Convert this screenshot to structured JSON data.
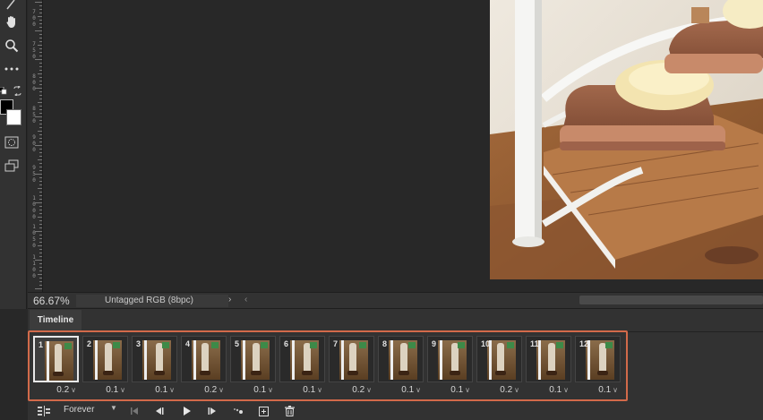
{
  "status": {
    "zoom": "66.67%",
    "color_profile": "Untagged RGB (8bpc)",
    "next_glyph": "›",
    "prev_glyph": "‹"
  },
  "panel": {
    "tab_label": "Timeline"
  },
  "ruler": {
    "labels": [
      "7\n0\n0",
      "7\n5\n0",
      "8\n0\n0",
      "8\n5\n0",
      "9\n0\n0",
      "9\n5\n0",
      "1\n0\n0\n0",
      "1\n0\n5\n0",
      "1\n1\n0\n0"
    ]
  },
  "frames": [
    {
      "num": "1",
      "delay": "0.2",
      "selected": true
    },
    {
      "num": "2",
      "delay": "0.1",
      "selected": false
    },
    {
      "num": "3",
      "delay": "0.1",
      "selected": false
    },
    {
      "num": "4",
      "delay": "0.2",
      "selected": false
    },
    {
      "num": "5",
      "delay": "0.1",
      "selected": false
    },
    {
      "num": "6",
      "delay": "0.1",
      "selected": false
    },
    {
      "num": "7",
      "delay": "0.2",
      "selected": false
    },
    {
      "num": "8",
      "delay": "0.1",
      "selected": false
    },
    {
      "num": "9",
      "delay": "0.1",
      "selected": false
    },
    {
      "num": "10",
      "delay": "0.2",
      "selected": false
    },
    {
      "num": "11",
      "delay": "0.1",
      "selected": false
    },
    {
      "num": "12",
      "delay": "0.1",
      "selected": false
    }
  ],
  "controls": {
    "loop_value": "Forever"
  },
  "icons": {
    "convert": "convert-to-video-timeline-icon",
    "first": "first-frame-icon",
    "prev": "previous-frame-icon",
    "play": "play-icon",
    "next": "next-frame-icon",
    "tween": "tween-icon",
    "new": "new-frame-icon",
    "delete": "delete-frame-icon"
  },
  "colors": {
    "highlight": "#d26a4a",
    "panel": "#323232",
    "canvas": "#282828"
  }
}
